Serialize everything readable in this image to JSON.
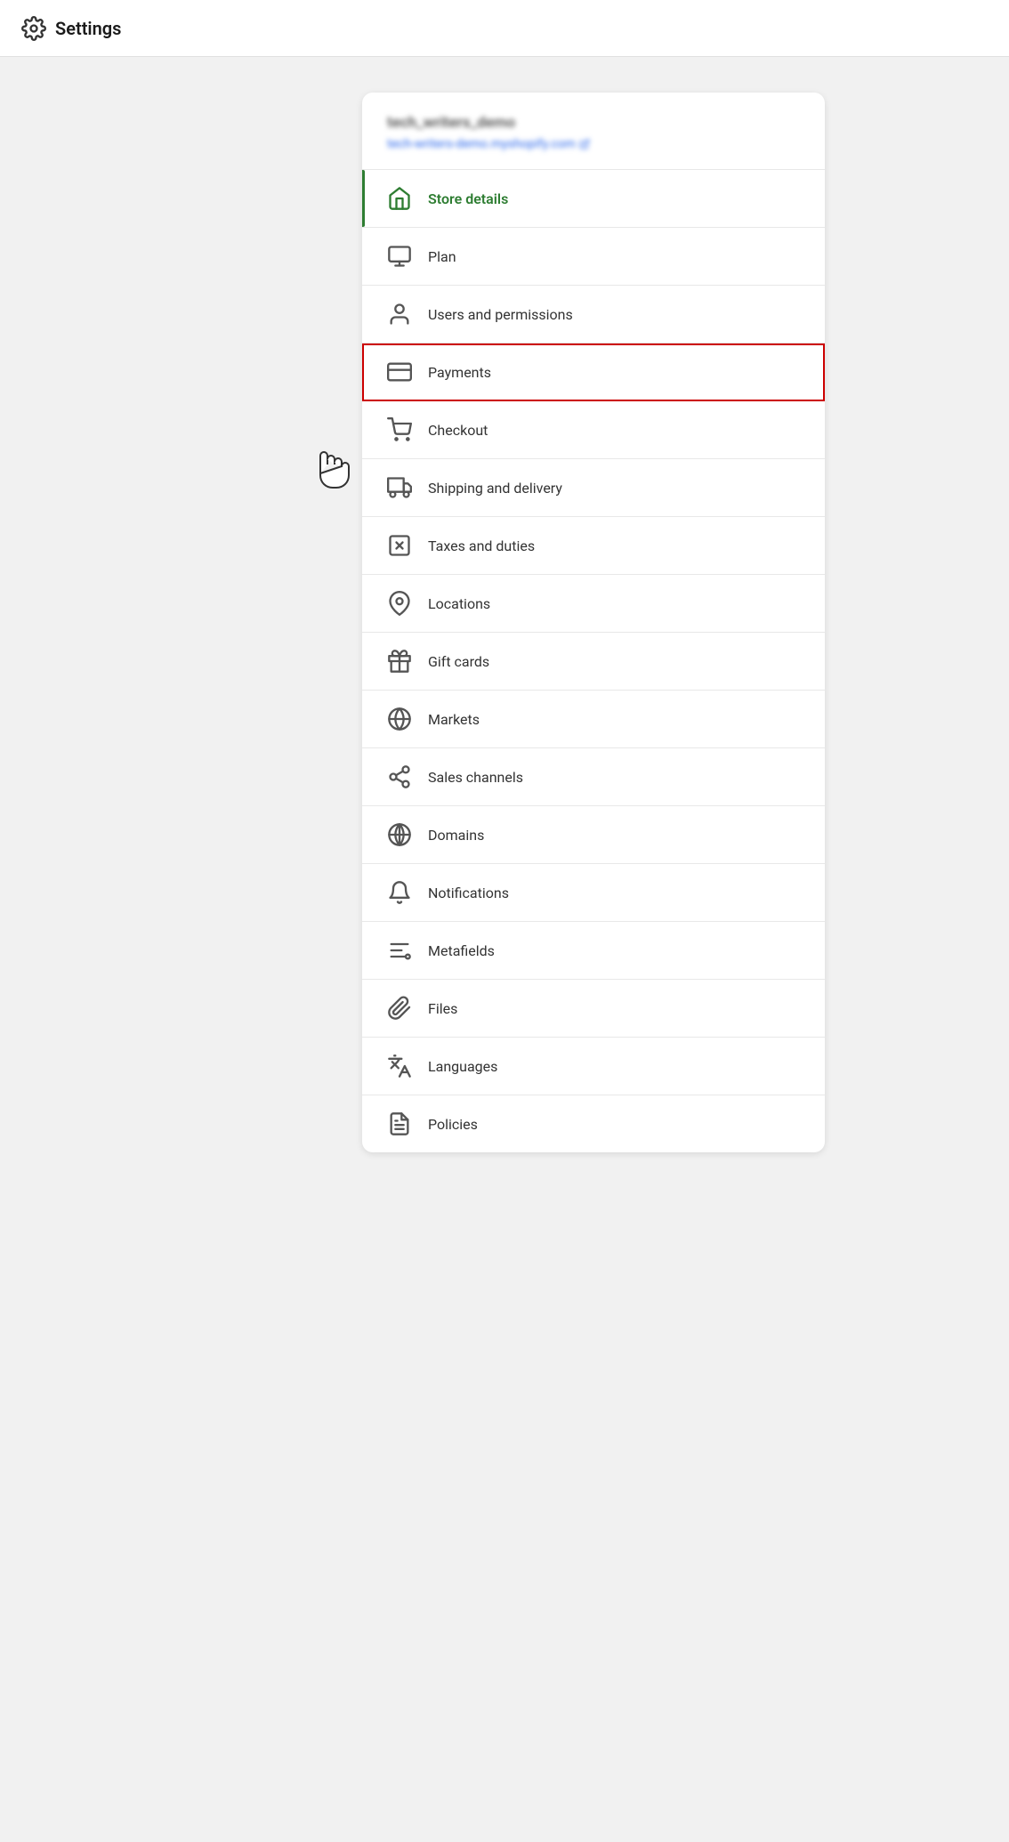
{
  "header": {
    "title": "Settings",
    "icon": "gear"
  },
  "store": {
    "name": "tech_writers_demo",
    "url": "tech-writers-demo.myshopify.com"
  },
  "nav_items": [
    {
      "id": "store-details",
      "label": "Store details",
      "icon": "store",
      "active": true
    },
    {
      "id": "plan",
      "label": "Plan",
      "icon": "plan"
    },
    {
      "id": "users-permissions",
      "label": "Users and permissions",
      "icon": "user"
    },
    {
      "id": "payments",
      "label": "Payments",
      "icon": "payments",
      "highlighted": true
    },
    {
      "id": "checkout",
      "label": "Checkout",
      "icon": "checkout"
    },
    {
      "id": "shipping-delivery",
      "label": "Shipping and delivery",
      "icon": "truck"
    },
    {
      "id": "taxes-duties",
      "label": "Taxes and duties",
      "icon": "taxes"
    },
    {
      "id": "locations",
      "label": "Locations",
      "icon": "location"
    },
    {
      "id": "gift-cards",
      "label": "Gift cards",
      "icon": "gift"
    },
    {
      "id": "markets",
      "label": "Markets",
      "icon": "globe"
    },
    {
      "id": "sales-channels",
      "label": "Sales channels",
      "icon": "channels"
    },
    {
      "id": "domains",
      "label": "Domains",
      "icon": "domains"
    },
    {
      "id": "notifications",
      "label": "Notifications",
      "icon": "bell"
    },
    {
      "id": "metafields",
      "label": "Metafields",
      "icon": "metafields"
    },
    {
      "id": "files",
      "label": "Files",
      "icon": "paperclip"
    },
    {
      "id": "languages",
      "label": "Languages",
      "icon": "languages"
    },
    {
      "id": "policies",
      "label": "Policies",
      "icon": "policies"
    }
  ]
}
